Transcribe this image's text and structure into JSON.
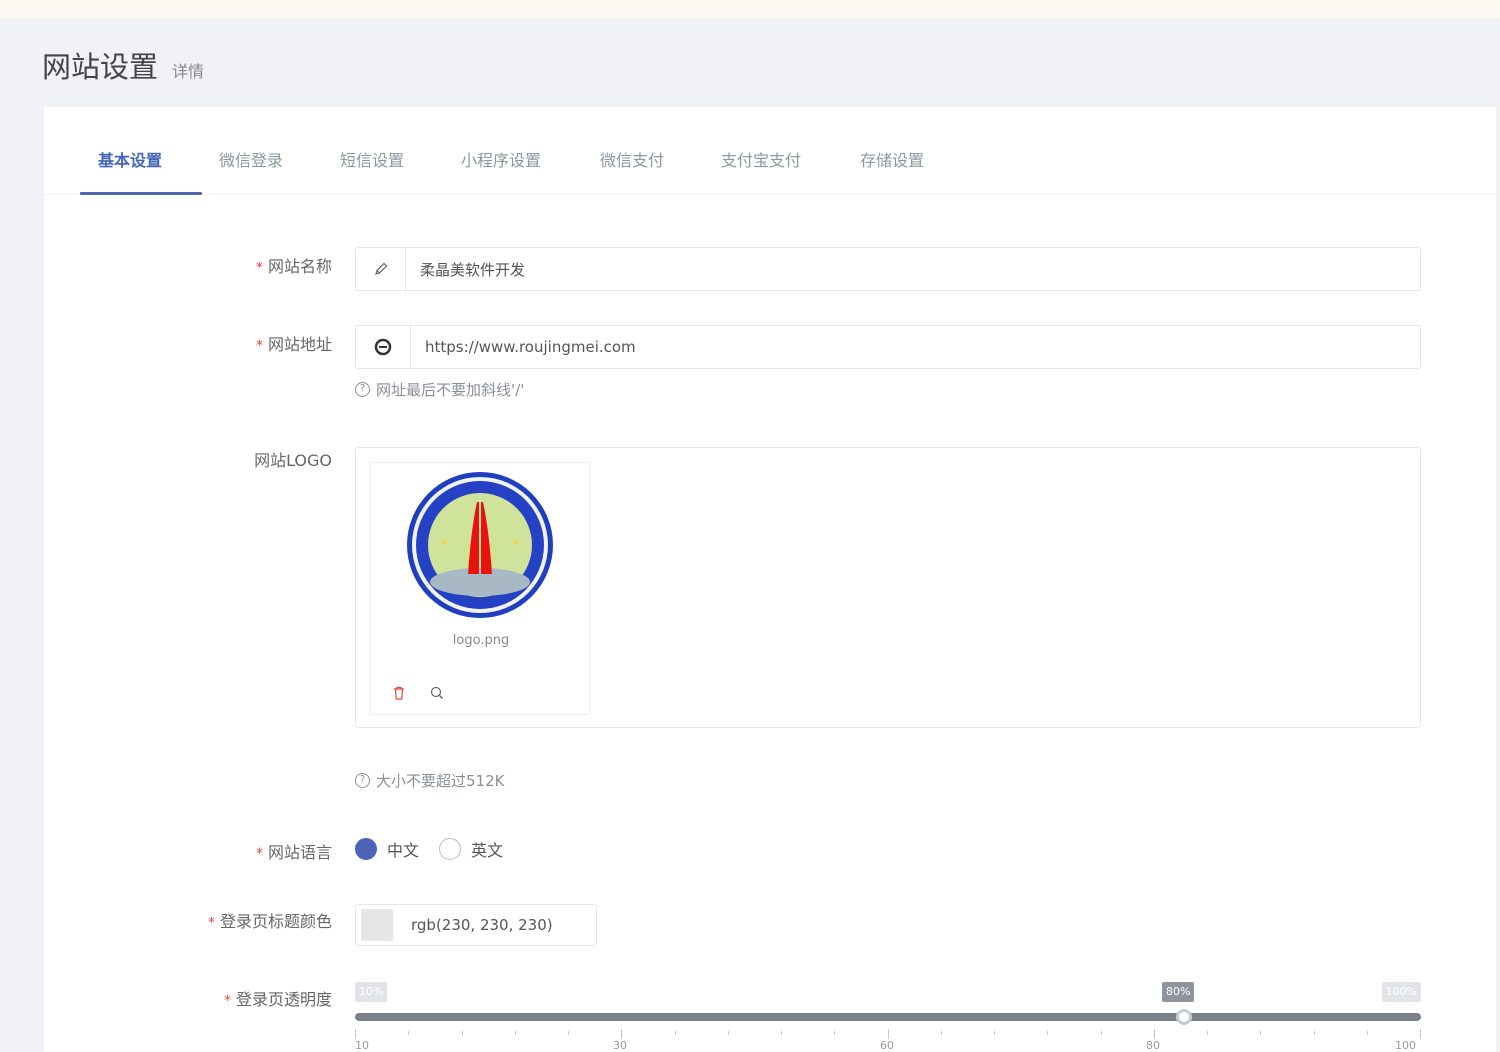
{
  "header": {
    "title": "网站设置",
    "subtitle": "详情"
  },
  "tabs": [
    {
      "label": "基本设置",
      "active": true
    },
    {
      "label": "微信登录"
    },
    {
      "label": "短信设置"
    },
    {
      "label": "小程序设置"
    },
    {
      "label": "微信支付"
    },
    {
      "label": "支付宝支付"
    },
    {
      "label": "存储设置"
    }
  ],
  "form": {
    "site_name": {
      "label": "网站名称",
      "required": true,
      "value": "柔晶美软件开发",
      "icon": "pencil-icon"
    },
    "site_url": {
      "label": "网站地址",
      "required": true,
      "value": "https://www.roujingmei.com",
      "icon": "browser-icon",
      "hint": "网址最后不要加斜线'/'"
    },
    "site_logo": {
      "label": "网站LOGO",
      "file_name": "logo.png",
      "hint": "大小不要超过512K"
    },
    "site_language": {
      "label": "网站语言",
      "required": true,
      "options": [
        "中文",
        "英文"
      ],
      "selected": "中文"
    },
    "login_title_color": {
      "label": "登录页标题颜色",
      "required": true,
      "value": "rgb(230, 230, 230)",
      "swatch": "#e6e6e6"
    },
    "login_opacity": {
      "label": "登录页透明度",
      "required": true,
      "min_label": "10%",
      "max_label": "100%",
      "current_label": "80%",
      "value": 80,
      "min": 10,
      "max": 100,
      "tick_labels": [
        "10",
        "30",
        "60",
        "80",
        "100"
      ]
    }
  },
  "colors": {
    "accent": "#4d63b8",
    "required": "#e8453c",
    "logo_ring": "#1f3fbf",
    "logo_tower": "#e8130f"
  }
}
